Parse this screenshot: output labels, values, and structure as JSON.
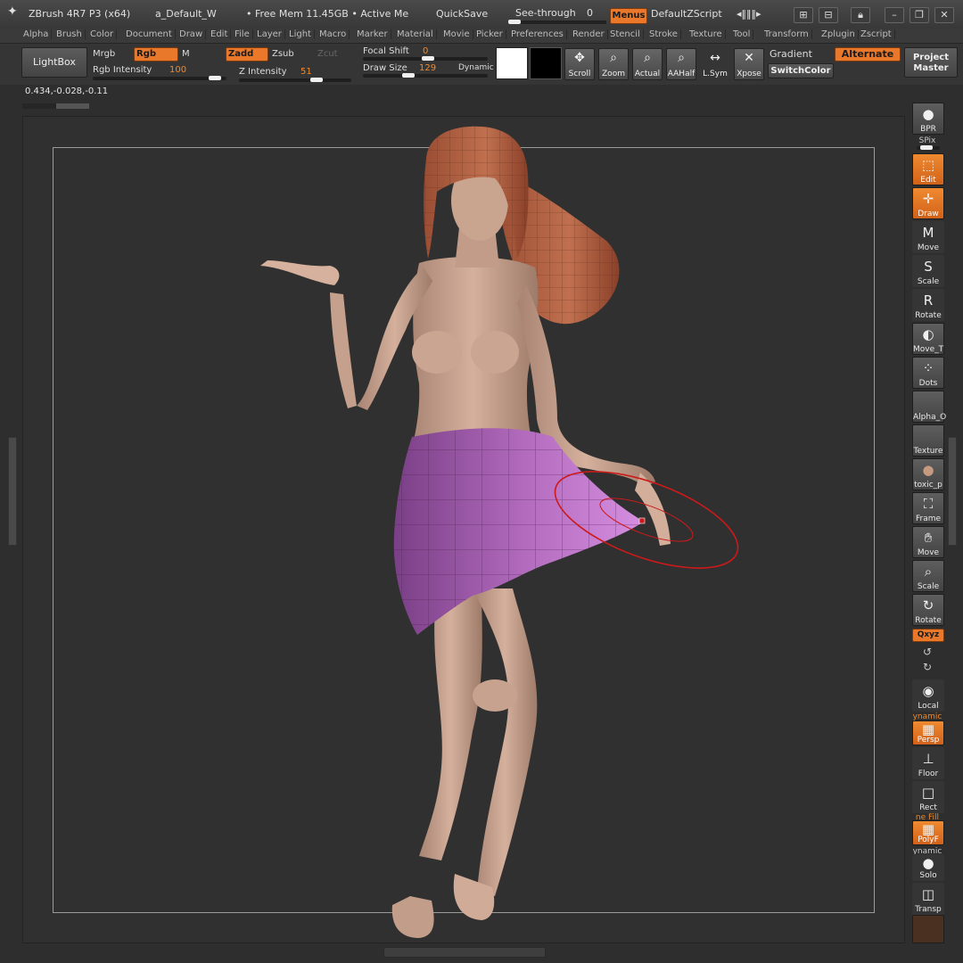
{
  "titlebar": {
    "app": "ZBrush 4R7 P3 (x64)",
    "doc": "a_Default_W",
    "mem": "• Free Mem 11.45GB • Active Me",
    "quicksave": "QuickSave",
    "seethrough": "See-through",
    "seethrough_val": "0",
    "menus": "Menus",
    "zscript": "DefaultZScript"
  },
  "menubar": [
    "Alpha",
    "Brush",
    "Color",
    "Document",
    "Draw",
    "Edit",
    "File",
    "Layer",
    "Light",
    "Macro",
    "Marker",
    "Material",
    "Movie",
    "Picker",
    "Preferences",
    "Render",
    "Stencil",
    "Stroke",
    "Texture",
    "Tool",
    "Transform",
    "Zplugin",
    "Zscript"
  ],
  "toolbar": {
    "lightbox": "LightBox",
    "mrgb": "Mrgb",
    "rgb": "Rgb",
    "m": "M",
    "zadd": "Zadd",
    "zsub": "Zsub",
    "zcut": "Zcut",
    "rgb_intensity_label": "Rgb Intensity",
    "rgb_intensity_val": "100",
    "z_intensity_label": "Z Intensity",
    "z_intensity_val": "51",
    "focal_label": "Focal Shift",
    "focal_val": "0",
    "drawsize_label": "Draw Size",
    "drawsize_val": "129",
    "dynamic": "Dynamic",
    "scroll": "Scroll",
    "zoom": "Zoom",
    "actual": "Actual",
    "aahalf": "AAHalf",
    "lsym": "L.Sym",
    "xpose": "Xpose",
    "gradient": "Gradient",
    "alternate": "Alternate",
    "switchcolor": "SwitchColor",
    "project": "Project",
    "master": "Master"
  },
  "coords": "0.434,-0.028,-0.11",
  "progress": 0.5,
  "shelf": {
    "bpr": "BPR",
    "spix": "SPix",
    "edit": "Edit",
    "draw": "Draw",
    "move": "Move",
    "scale": "Scale",
    "rotate": "Rotate",
    "move_t": "Move_T",
    "dots": "Dots",
    "alpha": "Alpha_O",
    "texture": "Texture",
    "material": "toxic_p",
    "frame": "Frame",
    "move2": "Move",
    "scale2": "Scale",
    "rotate2": "Rotate",
    "xyz": "Qxyz",
    "local": "Local",
    "dynamic_persp": "ynamic",
    "persp": "Persp",
    "floor": "Floor",
    "rect": "Rect",
    "line_fill": "ne Fill",
    "polyf": "PolyF",
    "dynamic_solo": "ynamic",
    "solo": "Solo",
    "transp": "Transp"
  },
  "colors": {
    "accent": "#e9782a",
    "skin": "#c9a390",
    "hair": "#b86444",
    "skirt": "#b070b8",
    "brush_ring": "#cc1a1a"
  }
}
